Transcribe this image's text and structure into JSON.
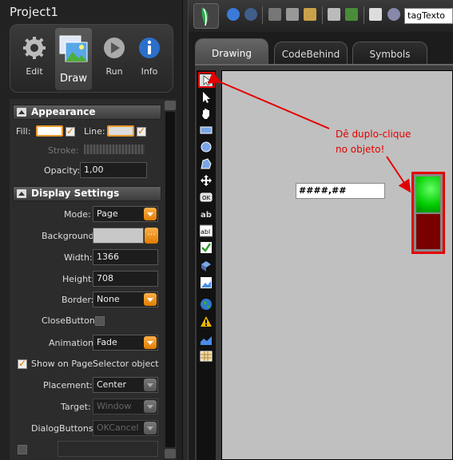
{
  "project": {
    "title": "Project1"
  },
  "modes": [
    {
      "label": "Edit"
    },
    {
      "label": "Draw"
    },
    {
      "label": "Run"
    },
    {
      "label": "Info"
    }
  ],
  "appearance": {
    "header": "Appearance",
    "fill_label": "Fill:",
    "line_label": "Line:",
    "stroke_label": "Stroke:",
    "opacity_label": "Opacity:",
    "opacity_value": "1,00"
  },
  "display": {
    "header": "Display Settings",
    "mode_label": "Mode:",
    "mode_value": "Page",
    "background_label": "Background:",
    "background_value": "",
    "width_label": "Width:",
    "width_value": "1366",
    "height_label": "Height:",
    "height_value": "708",
    "border_label": "Border:",
    "border_value": "None",
    "closebutton_label": "CloseButton:",
    "animation_label": "Animation:",
    "animation_value": "Fade",
    "show_on_selector_label": "Show on PageSelector object",
    "placement_label": "Placement:",
    "placement_value": "Center",
    "target_label": "Target:",
    "target_value": "Window",
    "dialogbuttons_label": "DialogButtons:",
    "dialogbuttons_value": "OKCancel"
  },
  "toolbar": {
    "tag_value": "tagTexto"
  },
  "tabs": [
    {
      "label": "Drawing"
    },
    {
      "label": "CodeBehind"
    },
    {
      "label": "Symbols"
    }
  ],
  "canvas": {
    "text_object_value": "####,##",
    "annotation_line1": "Dê duplo-clique",
    "annotation_line2": "no objeto!"
  },
  "colors": {
    "accent": "#e89a2c",
    "annotation": "#e30000",
    "gauge_on": "#00cc00",
    "gauge_off": "#7a0000"
  }
}
